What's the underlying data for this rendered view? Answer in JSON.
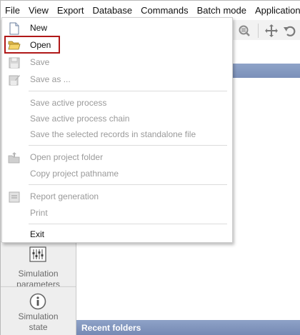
{
  "menubar": {
    "items": [
      "File",
      "View",
      "Export",
      "Database",
      "Commands",
      "Batch mode",
      "Applications"
    ]
  },
  "file_menu": {
    "items": {
      "new": "New",
      "open": "Open",
      "save": "Save",
      "save_as": "Save as ...",
      "save_active_process": "Save active process",
      "save_active_chain": "Save active process chain",
      "save_selected": "Save the selected records in standalone file",
      "open_project_folder": "Open project folder",
      "copy_project_pathname": "Copy project pathname",
      "report_generation": "Report generation",
      "print": "Print",
      "exit": "Exit"
    }
  },
  "sidebar": {
    "simulation_parameters": "Simulation\nparameters",
    "simulation_parameters_l1": "Simulation",
    "simulation_parameters_l2": "parameters",
    "simulation_state_l1": "Simulation",
    "simulation_state_l2": "state"
  },
  "main": {
    "recent_folders": "Recent folders"
  },
  "colors": {
    "highlight": "#b01818",
    "panel_header": "#7b90b9"
  },
  "icons": [
    "new-file-icon",
    "open-folder-icon",
    "save-icon",
    "save-as-icon",
    "open-project-folder-icon",
    "report-icon",
    "zoom-icon",
    "move-icon",
    "undo-icon",
    "simulation-parameters-icon",
    "info-icon"
  ]
}
